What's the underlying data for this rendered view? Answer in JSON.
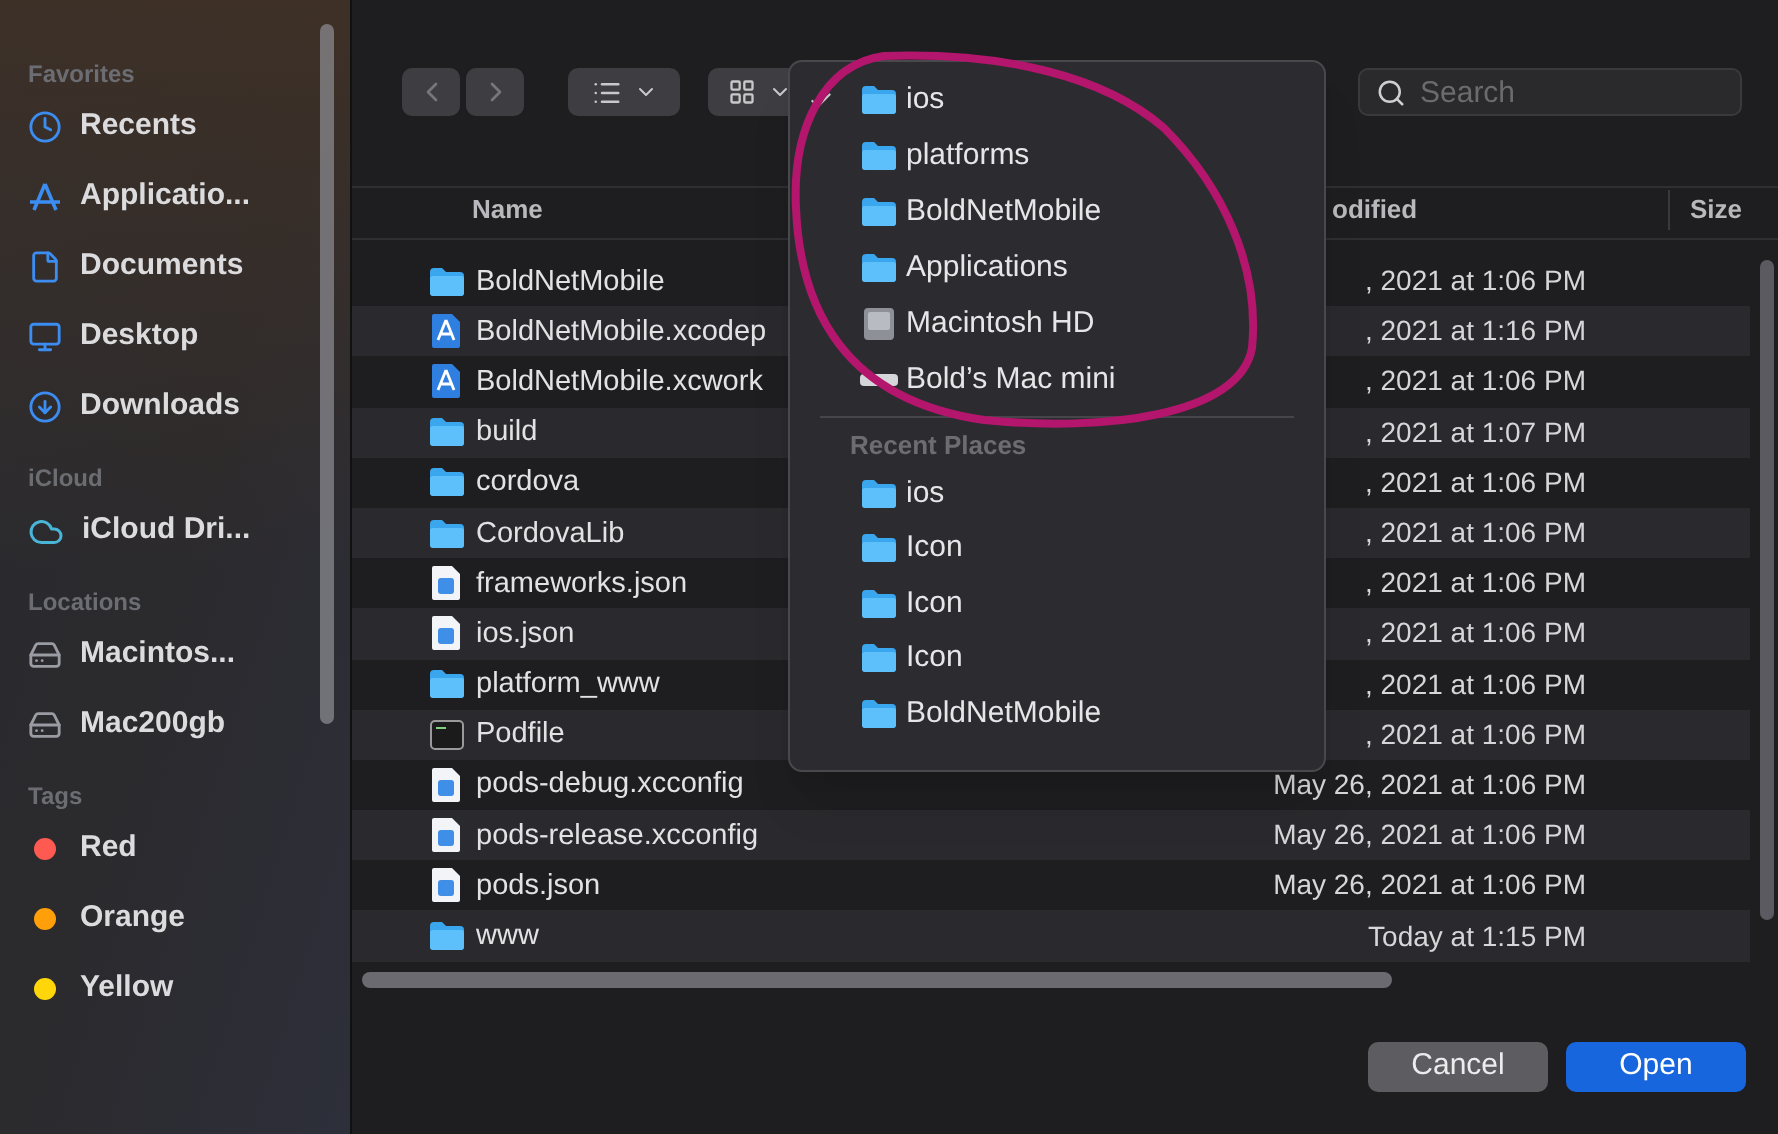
{
  "sidebar": {
    "sections": [
      {
        "heading": "Favorites",
        "items": [
          {
            "label": "Recents"
          },
          {
            "label": "Applicatio..."
          },
          {
            "label": "Documents"
          },
          {
            "label": "Desktop"
          },
          {
            "label": "Downloads"
          }
        ]
      },
      {
        "heading": "iCloud",
        "items": [
          {
            "label": "iCloud Dri..."
          }
        ]
      },
      {
        "heading": "Locations",
        "items": [
          {
            "label": "Macintos..."
          },
          {
            "label": "Mac200gb"
          }
        ]
      },
      {
        "heading": "Tags",
        "items": [
          {
            "label": "Red",
            "color": "#ff5a52"
          },
          {
            "label": "Orange",
            "color": "#ff9f0a"
          },
          {
            "label": "Yellow",
            "color": "#ffd60a"
          }
        ]
      }
    ]
  },
  "toolbar": {
    "search": {
      "placeholder": "Search"
    }
  },
  "table": {
    "columns": [
      "Name",
      "odified",
      "Size"
    ],
    "rows": [
      {
        "kind": "folder",
        "name": "BoldNetMobile",
        "modified": ", 2021 at 1:06 PM"
      },
      {
        "kind": "xcode",
        "name": "BoldNetMobile.xcodep",
        "modified": ", 2021 at 1:16 PM"
      },
      {
        "kind": "xcode",
        "name": "BoldNetMobile.xcwork",
        "modified": ", 2021 at 1:06 PM"
      },
      {
        "kind": "folder",
        "name": "build",
        "modified": ", 2021 at 1:07 PM"
      },
      {
        "kind": "folder",
        "name": "cordova",
        "modified": ", 2021 at 1:06 PM"
      },
      {
        "kind": "folder",
        "name": "CordovaLib",
        "modified": ", 2021 at 1:06 PM"
      },
      {
        "kind": "document",
        "name": "frameworks.json",
        "modified": ", 2021 at 1:06 PM"
      },
      {
        "kind": "document",
        "name": "ios.json",
        "modified": ", 2021 at 1:06 PM"
      },
      {
        "kind": "folder",
        "name": "platform_www",
        "modified": ", 2021 at 1:06 PM"
      },
      {
        "kind": "terminal",
        "name": "Podfile",
        "modified": ", 2021 at 1:06 PM"
      },
      {
        "kind": "document",
        "name": "pods-debug.xcconfig",
        "modified": "May 26, 2021 at 1:06 PM"
      },
      {
        "kind": "document",
        "name": "pods-release.xcconfig",
        "modified": "May 26, 2021 at 1:06 PM"
      },
      {
        "kind": "document",
        "name": "pods.json",
        "modified": "May 26, 2021 at 1:06 PM"
      },
      {
        "kind": "folder",
        "name": "www",
        "modified": "Today at 1:15 PM"
      }
    ]
  },
  "path_menu": {
    "items": [
      {
        "kind": "folder",
        "label": "ios",
        "checked": true
      },
      {
        "kind": "folder",
        "label": "platforms",
        "checked": false
      },
      {
        "kind": "folder",
        "label": "BoldNetMobile",
        "checked": false
      },
      {
        "kind": "folder",
        "label": "Applications",
        "checked": false
      },
      {
        "kind": "disk",
        "label": "Macintosh HD",
        "checked": false
      },
      {
        "kind": "computer",
        "label": "Bold’s Mac mini",
        "checked": false
      }
    ],
    "recent_heading": "Recent Places",
    "recent": [
      {
        "kind": "folder",
        "label": "ios"
      },
      {
        "kind": "folder",
        "label": "Icon"
      },
      {
        "kind": "folder",
        "label": "Icon"
      },
      {
        "kind": "folder",
        "label": "Icon"
      },
      {
        "kind": "folder",
        "label": "BoldNetMobile"
      }
    ]
  },
  "buttons": [
    {
      "label": "Cancel",
      "kind": "secondary"
    },
    {
      "label": "Open",
      "kind": "primary"
    }
  ]
}
